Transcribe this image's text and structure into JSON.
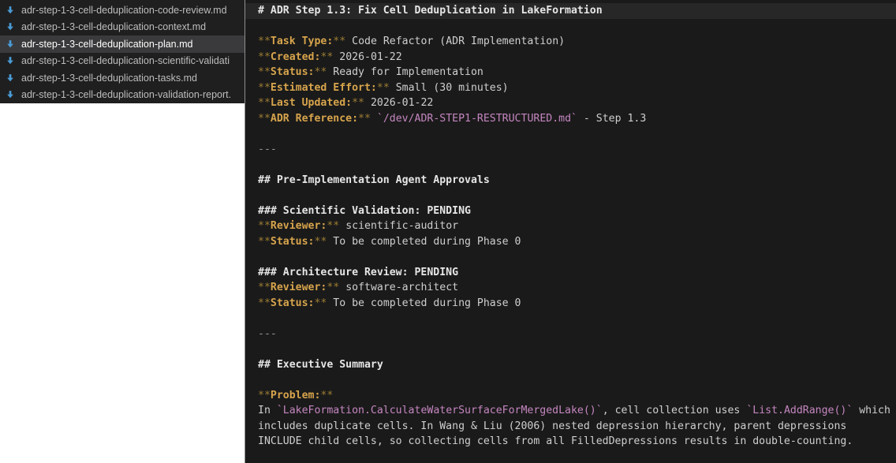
{
  "colors": {
    "page_bg": "#ffffff",
    "panel_bg": "#1f1f1f",
    "panel_row_selected_bg": "#3a3a3c",
    "panel_text": "#bdbdbd",
    "panel_text_selected": "#ffffff",
    "file_icon_blue": "#4a9bd5",
    "editor_bg": "#1a1a1a",
    "editor_border": "#8f8f8f",
    "current_line_bg": "#272727",
    "heading_text": "#e6e6e6",
    "body_text": "#cfcfcf",
    "bold_label": "#d7a44c",
    "bold_punct": "#9c7d33",
    "inline_code": "#c586c0",
    "hr_text": "#949494"
  },
  "file_list": {
    "items": [
      {
        "label": "adr-step-1-3-cell-deduplication-code-review.md",
        "selected": false,
        "icon": "download-arrow"
      },
      {
        "label": "adr-step-1-3-cell-deduplication-context.md",
        "selected": false,
        "icon": "download-arrow"
      },
      {
        "label": "adr-step-1-3-cell-deduplication-plan.md",
        "selected": true,
        "icon": "download-arrow"
      },
      {
        "label": "adr-step-1-3-cell-deduplication-scientific-validati",
        "selected": false,
        "icon": "download-arrow"
      },
      {
        "label": "adr-step-1-3-cell-deduplication-tasks.md",
        "selected": false,
        "icon": "download-arrow"
      },
      {
        "label": "adr-step-1-3-cell-deduplication-validation-report.",
        "selected": false,
        "icon": "download-arrow"
      }
    ]
  },
  "editor": {
    "lines": [
      {
        "current": true,
        "tokens": [
          {
            "t": "h",
            "v": "# ADR Step 1.3: Fix Cell Deduplication in LakeFormation"
          }
        ]
      },
      {
        "tokens": []
      },
      {
        "tokens": [
          {
            "t": "punct",
            "v": "**"
          },
          {
            "t": "label",
            "v": "Task Type:"
          },
          {
            "t": "punct",
            "v": "**"
          },
          {
            "t": "text",
            "v": " Code Refactor (ADR Implementation)"
          }
        ]
      },
      {
        "tokens": [
          {
            "t": "punct",
            "v": "**"
          },
          {
            "t": "label",
            "v": "Created:"
          },
          {
            "t": "punct",
            "v": "**"
          },
          {
            "t": "text",
            "v": " 2026-01-22"
          }
        ]
      },
      {
        "tokens": [
          {
            "t": "punct",
            "v": "**"
          },
          {
            "t": "label",
            "v": "Status:"
          },
          {
            "t": "punct",
            "v": "**"
          },
          {
            "t": "text",
            "v": " Ready for Implementation"
          }
        ]
      },
      {
        "tokens": [
          {
            "t": "punct",
            "v": "**"
          },
          {
            "t": "label",
            "v": "Estimated Effort:"
          },
          {
            "t": "punct",
            "v": "**"
          },
          {
            "t": "text",
            "v": " Small (30 minutes)"
          }
        ]
      },
      {
        "tokens": [
          {
            "t": "punct",
            "v": "**"
          },
          {
            "t": "label",
            "v": "Last Updated:"
          },
          {
            "t": "punct",
            "v": "**"
          },
          {
            "t": "text",
            "v": " 2026-01-22"
          }
        ]
      },
      {
        "tokens": [
          {
            "t": "punct",
            "v": "**"
          },
          {
            "t": "label",
            "v": "ADR Reference:"
          },
          {
            "t": "punct",
            "v": "**"
          },
          {
            "t": "text",
            "v": " "
          },
          {
            "t": "code",
            "v": "`/dev/ADR-STEP1-RESTRUCTURED.md`"
          },
          {
            "t": "text",
            "v": " - Step 1.3"
          }
        ]
      },
      {
        "tokens": []
      },
      {
        "tokens": [
          {
            "t": "hr",
            "v": "---"
          }
        ]
      },
      {
        "tokens": []
      },
      {
        "tokens": [
          {
            "t": "h",
            "v": "## Pre-Implementation Agent Approvals"
          }
        ]
      },
      {
        "tokens": []
      },
      {
        "tokens": [
          {
            "t": "h",
            "v": "### Scientific Validation: PENDING"
          }
        ]
      },
      {
        "tokens": [
          {
            "t": "punct",
            "v": "**"
          },
          {
            "t": "label",
            "v": "Reviewer:"
          },
          {
            "t": "punct",
            "v": "**"
          },
          {
            "t": "text",
            "v": " scientific-auditor"
          }
        ]
      },
      {
        "tokens": [
          {
            "t": "punct",
            "v": "**"
          },
          {
            "t": "label",
            "v": "Status:"
          },
          {
            "t": "punct",
            "v": "**"
          },
          {
            "t": "text",
            "v": " To be completed during Phase 0"
          }
        ]
      },
      {
        "tokens": []
      },
      {
        "tokens": [
          {
            "t": "h",
            "v": "### Architecture Review: PENDING"
          }
        ]
      },
      {
        "tokens": [
          {
            "t": "punct",
            "v": "**"
          },
          {
            "t": "label",
            "v": "Reviewer:"
          },
          {
            "t": "punct",
            "v": "**"
          },
          {
            "t": "text",
            "v": " software-architect"
          }
        ]
      },
      {
        "tokens": [
          {
            "t": "punct",
            "v": "**"
          },
          {
            "t": "label",
            "v": "Status:"
          },
          {
            "t": "punct",
            "v": "**"
          },
          {
            "t": "text",
            "v": " To be completed during Phase 0"
          }
        ]
      },
      {
        "tokens": []
      },
      {
        "tokens": [
          {
            "t": "hr",
            "v": "---"
          }
        ]
      },
      {
        "tokens": []
      },
      {
        "tokens": [
          {
            "t": "h",
            "v": "## Executive Summary"
          }
        ]
      },
      {
        "tokens": []
      },
      {
        "tokens": [
          {
            "t": "punct",
            "v": "**"
          },
          {
            "t": "label",
            "v": "Problem:"
          },
          {
            "t": "punct",
            "v": "**"
          }
        ]
      },
      {
        "tokens": [
          {
            "t": "text",
            "v": "In "
          },
          {
            "t": "code",
            "v": "`LakeFormation.CalculateWaterSurfaceForMergedLake()`"
          },
          {
            "t": "text",
            "v": ", cell collection uses "
          },
          {
            "t": "code",
            "v": "`List.AddRange()`"
          },
          {
            "t": "text",
            "v": " which"
          }
        ]
      },
      {
        "tokens": [
          {
            "t": "text",
            "v": "includes duplicate cells. In Wang & Liu (2006) nested depression hierarchy, parent depressions"
          }
        ]
      },
      {
        "tokens": [
          {
            "t": "text",
            "v": "INCLUDE child cells, so collecting cells from all FilledDepressions results in double-counting."
          }
        ]
      }
    ]
  }
}
